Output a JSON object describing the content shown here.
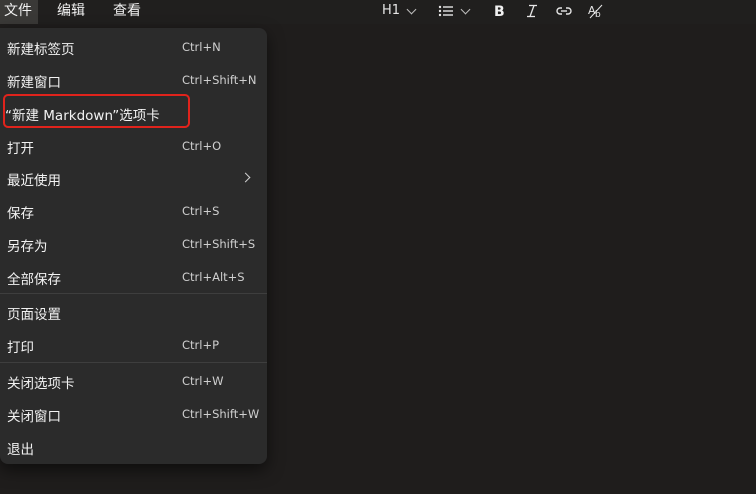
{
  "menubar": {
    "file": "文件",
    "edit": "编辑",
    "view": "查看"
  },
  "toolbar": {
    "heading": "H1",
    "list_icon": "list-icon",
    "bold_icon": "bold-icon",
    "italic_icon": "italic-icon",
    "link_icon": "link-icon",
    "strike_icon": "spellcheck-icon"
  },
  "file_menu": {
    "items": [
      {
        "label": "新建标签页",
        "shortcut": "Ctrl+N"
      },
      {
        "label": "新建窗口",
        "shortcut": "Ctrl+Shift+N"
      },
      {
        "label": "“新建 Markdown”选项卡",
        "shortcut": ""
      },
      {
        "label": "打开",
        "shortcut": "Ctrl+O"
      },
      {
        "label": "最近使用",
        "shortcut": ""
      },
      {
        "label": "保存",
        "shortcut": "Ctrl+S"
      },
      {
        "label": "另存为",
        "shortcut": "Ctrl+Shift+S"
      },
      {
        "label": "全部保存",
        "shortcut": "Ctrl+Alt+S"
      },
      {
        "label": "页面设置",
        "shortcut": ""
      },
      {
        "label": "打印",
        "shortcut": "Ctrl+P"
      },
      {
        "label": "关闭选项卡",
        "shortcut": "Ctrl+W"
      },
      {
        "label": "关闭窗口",
        "shortcut": "Ctrl+Shift+W"
      },
      {
        "label": "退出",
        "shortcut": ""
      }
    ]
  },
  "colors": {
    "background": "#1f1d1c",
    "menu_bg": "#2b2b2b",
    "highlight_border": "#e0231c"
  }
}
